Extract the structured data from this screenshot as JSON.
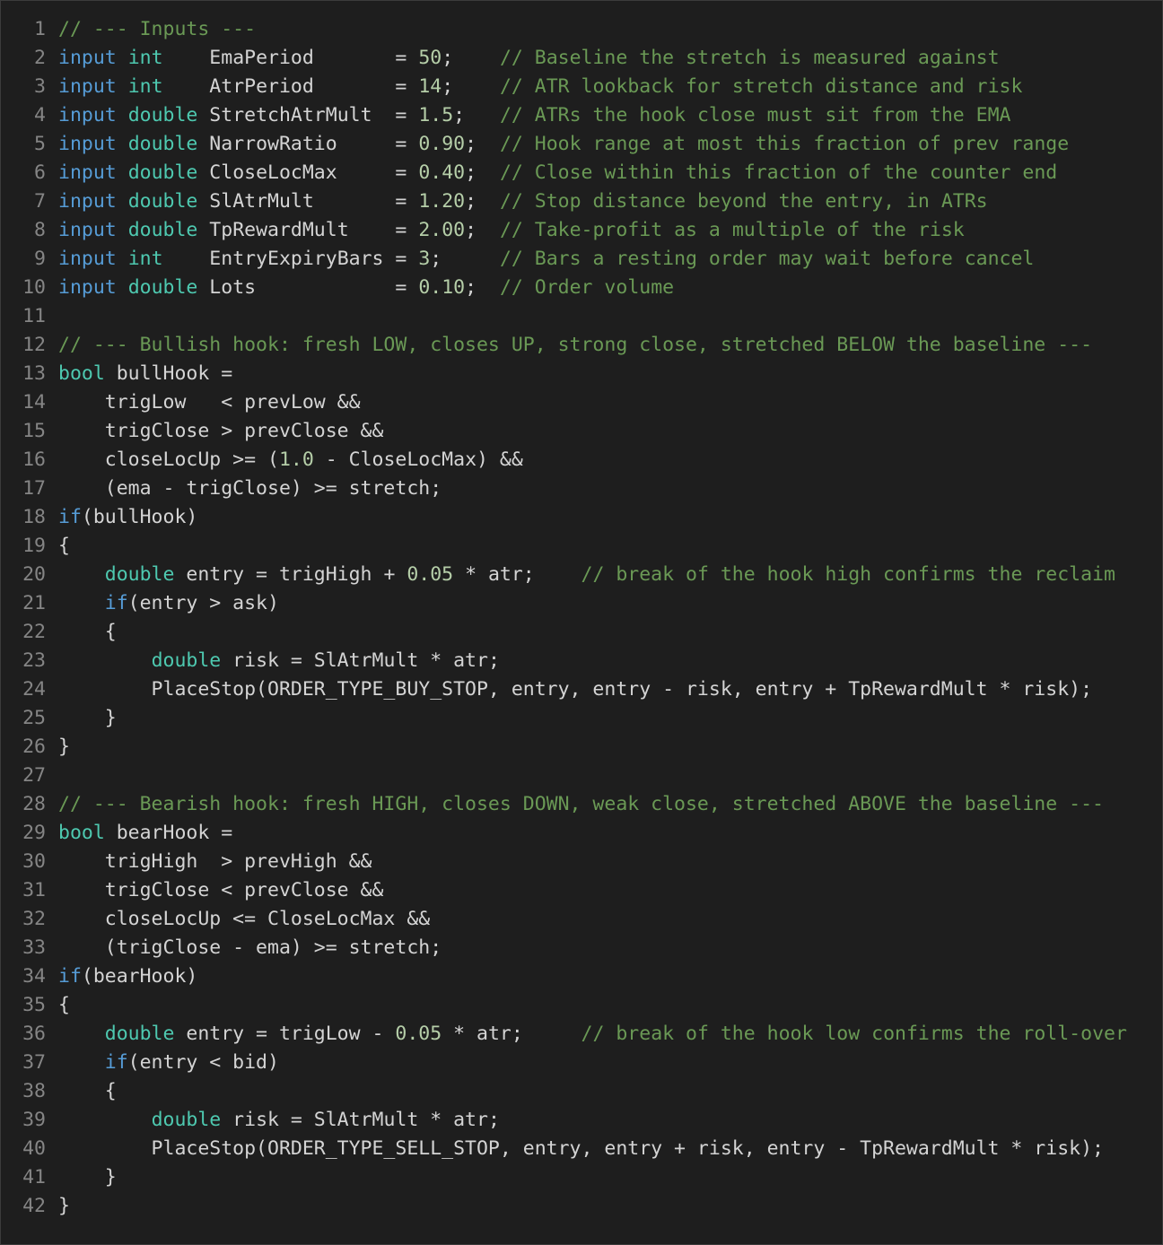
{
  "editor": {
    "language": "MQL5",
    "colors": {
      "background": "#1e1e1e",
      "text": "#d4d4d4",
      "keyword": "#569cd6",
      "type": "#4ec9b0",
      "comment": "#6a9955",
      "number": "#b5cea8",
      "line_number": "#858585"
    },
    "lines": [
      {
        "n": "1",
        "tokens": [
          [
            "c",
            "// --- Inputs ---"
          ]
        ]
      },
      {
        "n": "2",
        "tokens": [
          [
            "k",
            "input"
          ],
          [
            "p",
            " "
          ],
          [
            "t",
            "int"
          ],
          [
            "p",
            "    EmaPeriod       = "
          ],
          [
            "n",
            "50"
          ],
          [
            "p",
            ";    "
          ],
          [
            "c",
            "// Baseline the stretch is measured against"
          ]
        ]
      },
      {
        "n": "3",
        "tokens": [
          [
            "k",
            "input"
          ],
          [
            "p",
            " "
          ],
          [
            "t",
            "int"
          ],
          [
            "p",
            "    AtrPeriod       = "
          ],
          [
            "n",
            "14"
          ],
          [
            "p",
            ";    "
          ],
          [
            "c",
            "// ATR lookback for stretch distance and risk"
          ]
        ]
      },
      {
        "n": "4",
        "tokens": [
          [
            "k",
            "input"
          ],
          [
            "p",
            " "
          ],
          [
            "t",
            "double"
          ],
          [
            "p",
            " StretchAtrMult  = "
          ],
          [
            "n",
            "1.5"
          ],
          [
            "p",
            ";   "
          ],
          [
            "c",
            "// ATRs the hook close must sit from the EMA"
          ]
        ]
      },
      {
        "n": "5",
        "tokens": [
          [
            "k",
            "input"
          ],
          [
            "p",
            " "
          ],
          [
            "t",
            "double"
          ],
          [
            "p",
            " NarrowRatio     = "
          ],
          [
            "n",
            "0.90"
          ],
          [
            "p",
            ";  "
          ],
          [
            "c",
            "// Hook range at most this fraction of prev range"
          ]
        ]
      },
      {
        "n": "6",
        "tokens": [
          [
            "k",
            "input"
          ],
          [
            "p",
            " "
          ],
          [
            "t",
            "double"
          ],
          [
            "p",
            " CloseLocMax     = "
          ],
          [
            "n",
            "0.40"
          ],
          [
            "p",
            ";  "
          ],
          [
            "c",
            "// Close within this fraction of the counter end"
          ]
        ]
      },
      {
        "n": "7",
        "tokens": [
          [
            "k",
            "input"
          ],
          [
            "p",
            " "
          ],
          [
            "t",
            "double"
          ],
          [
            "p",
            " SlAtrMult       = "
          ],
          [
            "n",
            "1.20"
          ],
          [
            "p",
            ";  "
          ],
          [
            "c",
            "// Stop distance beyond the entry, in ATRs"
          ]
        ]
      },
      {
        "n": "8",
        "tokens": [
          [
            "k",
            "input"
          ],
          [
            "p",
            " "
          ],
          [
            "t",
            "double"
          ],
          [
            "p",
            " TpRewardMult    = "
          ],
          [
            "n",
            "2.00"
          ],
          [
            "p",
            ";  "
          ],
          [
            "c",
            "// Take-profit as a multiple of the risk"
          ]
        ]
      },
      {
        "n": "9",
        "tokens": [
          [
            "k",
            "input"
          ],
          [
            "p",
            " "
          ],
          [
            "t",
            "int"
          ],
          [
            "p",
            "    EntryExpiryBars = "
          ],
          [
            "n",
            "3"
          ],
          [
            "p",
            ";     "
          ],
          [
            "c",
            "// Bars a resting order may wait before cancel"
          ]
        ]
      },
      {
        "n": "10",
        "tokens": [
          [
            "k",
            "input"
          ],
          [
            "p",
            " "
          ],
          [
            "t",
            "double"
          ],
          [
            "p",
            " Lots            = "
          ],
          [
            "n",
            "0.10"
          ],
          [
            "p",
            ";  "
          ],
          [
            "c",
            "// Order volume"
          ]
        ]
      },
      {
        "n": "11",
        "tokens": []
      },
      {
        "n": "12",
        "tokens": [
          [
            "c",
            "// --- Bullish hook: fresh LOW, closes UP, strong close, stretched BELOW the baseline ---"
          ]
        ]
      },
      {
        "n": "13",
        "tokens": [
          [
            "t",
            "bool"
          ],
          [
            "p",
            " bullHook ="
          ]
        ]
      },
      {
        "n": "14",
        "tokens": [
          [
            "p",
            "    trigLow   < prevLow &&"
          ]
        ]
      },
      {
        "n": "15",
        "tokens": [
          [
            "p",
            "    trigClose > prevClose &&"
          ]
        ]
      },
      {
        "n": "16",
        "tokens": [
          [
            "p",
            "    closeLocUp >= ("
          ],
          [
            "n",
            "1.0"
          ],
          [
            "p",
            " - CloseLocMax) &&"
          ]
        ]
      },
      {
        "n": "17",
        "tokens": [
          [
            "p",
            "    (ema - trigClose) >= stretch;"
          ]
        ]
      },
      {
        "n": "18",
        "tokens": [
          [
            "k",
            "if"
          ],
          [
            "p",
            "(bullHook)"
          ]
        ]
      },
      {
        "n": "19",
        "tokens": [
          [
            "p",
            "{"
          ]
        ]
      },
      {
        "n": "20",
        "tokens": [
          [
            "p",
            "    "
          ],
          [
            "t",
            "double"
          ],
          [
            "p",
            " entry = trigHigh + "
          ],
          [
            "n",
            "0.05"
          ],
          [
            "p",
            " * atr;    "
          ],
          [
            "c",
            "// break of the hook high confirms the reclaim"
          ]
        ]
      },
      {
        "n": "21",
        "tokens": [
          [
            "p",
            "    "
          ],
          [
            "k",
            "if"
          ],
          [
            "p",
            "(entry > ask)"
          ]
        ]
      },
      {
        "n": "22",
        "tokens": [
          [
            "p",
            "    {"
          ]
        ]
      },
      {
        "n": "23",
        "tokens": [
          [
            "p",
            "        "
          ],
          [
            "t",
            "double"
          ],
          [
            "p",
            " risk = SlAtrMult * atr;"
          ]
        ]
      },
      {
        "n": "24",
        "tokens": [
          [
            "p",
            "        PlaceStop(ORDER_TYPE_BUY_STOP, entry, entry - risk, entry + TpRewardMult * risk);"
          ]
        ]
      },
      {
        "n": "25",
        "tokens": [
          [
            "p",
            "    }"
          ]
        ]
      },
      {
        "n": "26",
        "tokens": [
          [
            "p",
            "}"
          ]
        ]
      },
      {
        "n": "27",
        "tokens": []
      },
      {
        "n": "28",
        "tokens": [
          [
            "c",
            "// --- Bearish hook: fresh HIGH, closes DOWN, weak close, stretched ABOVE the baseline ---"
          ]
        ]
      },
      {
        "n": "29",
        "tokens": [
          [
            "t",
            "bool"
          ],
          [
            "p",
            " bearHook ="
          ]
        ]
      },
      {
        "n": "30",
        "tokens": [
          [
            "p",
            "    trigHigh  > prevHigh &&"
          ]
        ]
      },
      {
        "n": "31",
        "tokens": [
          [
            "p",
            "    trigClose < prevClose &&"
          ]
        ]
      },
      {
        "n": "32",
        "tokens": [
          [
            "p",
            "    closeLocUp <= CloseLocMax &&"
          ]
        ]
      },
      {
        "n": "33",
        "tokens": [
          [
            "p",
            "    (trigClose - ema) >= stretch;"
          ]
        ]
      },
      {
        "n": "34",
        "tokens": [
          [
            "k",
            "if"
          ],
          [
            "p",
            "(bearHook)"
          ]
        ]
      },
      {
        "n": "35",
        "tokens": [
          [
            "p",
            "{"
          ]
        ]
      },
      {
        "n": "36",
        "tokens": [
          [
            "p",
            "    "
          ],
          [
            "t",
            "double"
          ],
          [
            "p",
            " entry = trigLow - "
          ],
          [
            "n",
            "0.05"
          ],
          [
            "p",
            " * atr;     "
          ],
          [
            "c",
            "// break of the hook low confirms the roll-over"
          ]
        ]
      },
      {
        "n": "37",
        "tokens": [
          [
            "p",
            "    "
          ],
          [
            "k",
            "if"
          ],
          [
            "p",
            "(entry < bid)"
          ]
        ]
      },
      {
        "n": "38",
        "tokens": [
          [
            "p",
            "    {"
          ]
        ]
      },
      {
        "n": "39",
        "tokens": [
          [
            "p",
            "        "
          ],
          [
            "t",
            "double"
          ],
          [
            "p",
            " risk = SlAtrMult * atr;"
          ]
        ]
      },
      {
        "n": "40",
        "tokens": [
          [
            "p",
            "        PlaceStop(ORDER_TYPE_SELL_STOP, entry, entry + risk, entry - TpRewardMult * risk);"
          ]
        ]
      },
      {
        "n": "41",
        "tokens": [
          [
            "p",
            "    }"
          ]
        ]
      },
      {
        "n": "42",
        "tokens": [
          [
            "p",
            "}"
          ]
        ]
      }
    ]
  }
}
